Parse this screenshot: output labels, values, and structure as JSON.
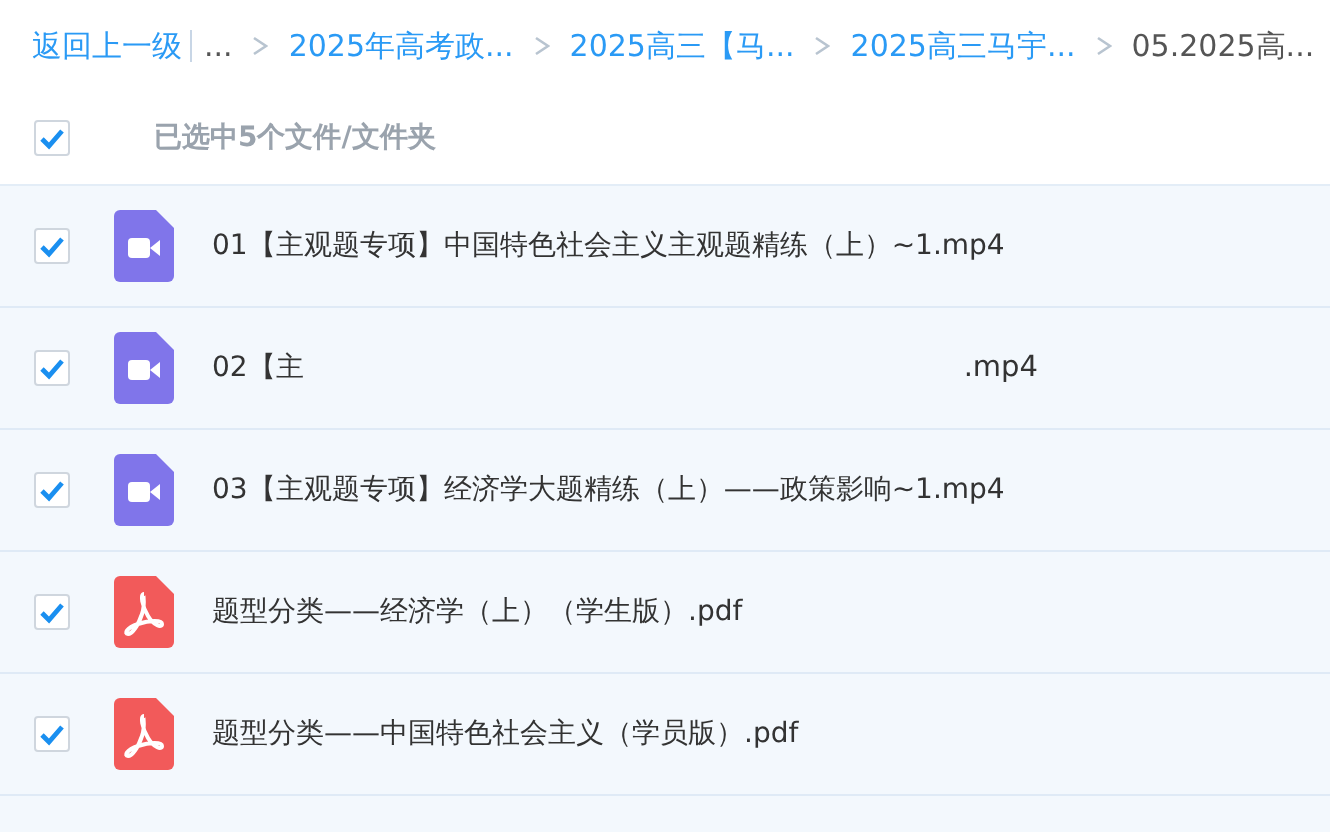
{
  "breadcrumb": {
    "back": "返回上一级",
    "items": [
      {
        "label": "...",
        "kind": "plain"
      },
      {
        "label": "2025年高考政...",
        "kind": "link"
      },
      {
        "label": "2025高三【马...",
        "kind": "link"
      },
      {
        "label": "2025高三马宇...",
        "kind": "link"
      },
      {
        "label": "05.2025高...",
        "kind": "current"
      }
    ]
  },
  "toolbar": {
    "select_all": {
      "checked": true
    },
    "status": "已选中5个文件/文件夹"
  },
  "files": [
    {
      "kind": "video",
      "checked": true,
      "name": "01【主观题专项】中国特色社会主义主观题精练（上）~1.mp4"
    },
    {
      "kind": "video",
      "checked": true,
      "name": "02【主",
      "name_end": ".mp4"
    },
    {
      "kind": "video",
      "checked": true,
      "name": "03【主观题专项】经济学大题精练（上）——政策影响~1.mp4"
    },
    {
      "kind": "pdf",
      "checked": true,
      "name": "题型分类——经济学（上）（学生版）.pdf"
    },
    {
      "kind": "pdf",
      "checked": true,
      "name": "题型分类——中国特色社会主义（学员版）.pdf"
    }
  ]
}
